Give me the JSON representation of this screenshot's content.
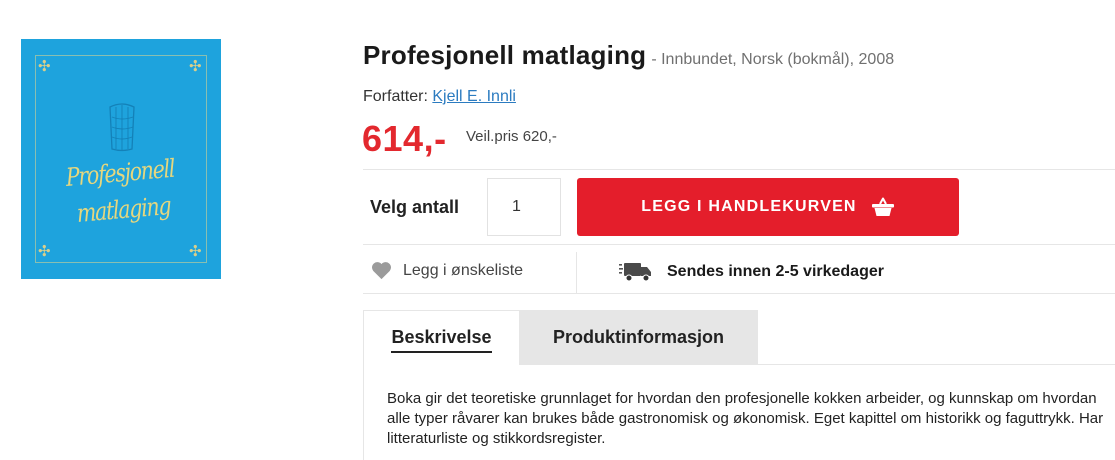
{
  "product": {
    "cover_title_line1": "Profesjonell",
    "cover_title_line2": "matlaging",
    "title": "Profesjonell matlaging",
    "meta": " - Innbundet, Norsk (bokmål), 2008",
    "author_label": "Forfatter: ",
    "author_name": "Kjell E. Innli",
    "price": "614,-",
    "list_price": "Veil.pris 620,-"
  },
  "purchase": {
    "quantity_label": "Velg antall",
    "quantity_value": "1",
    "add_to_cart_label": "LEGG I HANDLEKURVEN"
  },
  "extras": {
    "wishlist_label": "Legg i ønskeliste",
    "shipping_label": "Sendes innen 2-5 virkedager"
  },
  "tabs": [
    {
      "label": "Beskrivelse",
      "active": true
    },
    {
      "label": "Produktinformasjon",
      "active": false
    }
  ],
  "description": "Boka gir det teoretiske grunnlaget for hvordan den profesjonelle kokken arbeider, og kunnskap om hvordan alle typer råvarer kan brukes både gastronomisk og økonomisk. Eget kapittel om historikk og faguttrykk. Har litteraturliste og stikkordsregister.",
  "colors": {
    "price": "#e3282e",
    "cart_button": "#e41e2b",
    "link": "#2b7bc0",
    "cover": "#1ea3dd",
    "inactive_tab": "#e6e6e6"
  },
  "icons": {
    "cart": "basket-icon",
    "wishlist": "heart-icon",
    "shipping": "delivery-truck-icon"
  }
}
